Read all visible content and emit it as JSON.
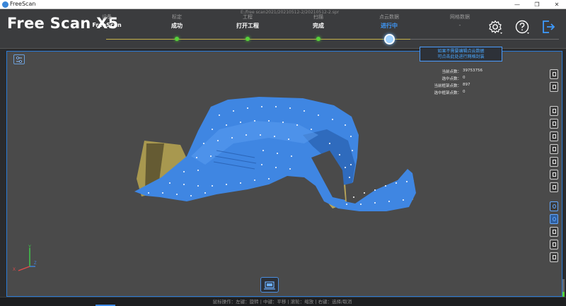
{
  "window": {
    "title": "FreeScan",
    "minimize": "—",
    "maximize": "❐",
    "close": "✕"
  },
  "header": {
    "brand": "Free Scan X5",
    "file_path": "E:/free scan2021/20210512-2/20210512-2.spr",
    "steps": [
      {
        "label": "设备",
        "value": "FreeScan",
        "state": "done"
      },
      {
        "label": "标定",
        "value": "成功",
        "state": "done"
      },
      {
        "label": "工程",
        "value": "打开工程",
        "state": "done"
      },
      {
        "label": "扫描",
        "value": "完成",
        "state": "done"
      },
      {
        "label": "点云数据",
        "value": "进行中",
        "state": "active"
      },
      {
        "label": "网格数据",
        "value": "-",
        "state": "pending"
      }
    ],
    "icons": [
      "settings-icon",
      "help-icon",
      "exit-icon"
    ]
  },
  "viewport": {
    "tip_lines": [
      "如果不需要编辑点云数据",
      "可点击此处进行网格封装"
    ],
    "stats": [
      {
        "label": "当前点数：",
        "value": "39753756"
      },
      {
        "label": "选中点数：",
        "value": "0"
      },
      {
        "label": "当前框架点数：",
        "value": "897"
      },
      {
        "label": "选中框架点数：",
        "value": "0"
      }
    ],
    "axis": {
      "x": "X",
      "y": "Y",
      "z": "Z"
    }
  },
  "footer": {
    "hint": "鼠标操作：左键：旋转 | 中键：平移 | 滚轮：缩放 | 右键：选择/取消",
    "left_text": "",
    "right_text": ""
  },
  "colors": {
    "accent": "#3e9bff",
    "mesh_blue": "#3f86e2",
    "mesh_gold": "#b8a45a",
    "step_done": "#57d13a",
    "progress_line": "#c7b34a"
  }
}
